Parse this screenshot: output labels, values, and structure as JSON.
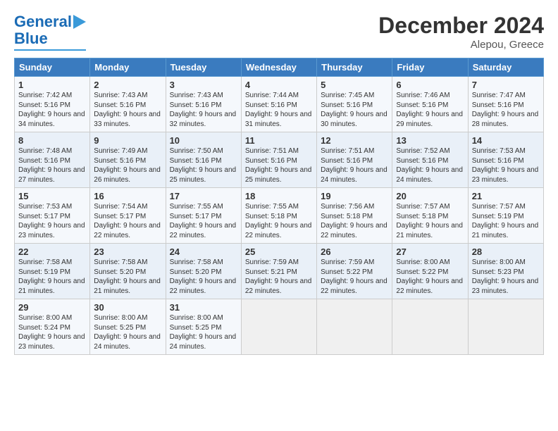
{
  "header": {
    "logo_line1": "General",
    "logo_line2": "Blue",
    "title": "December 2024",
    "subtitle": "Alepou, Greece"
  },
  "columns": [
    "Sunday",
    "Monday",
    "Tuesday",
    "Wednesday",
    "Thursday",
    "Friday",
    "Saturday"
  ],
  "weeks": [
    [
      {
        "day": "1",
        "sunrise": "7:42 AM",
        "sunset": "5:16 PM",
        "daylight": "9 hours and 34 minutes."
      },
      {
        "day": "2",
        "sunrise": "7:43 AM",
        "sunset": "5:16 PM",
        "daylight": "9 hours and 33 minutes."
      },
      {
        "day": "3",
        "sunrise": "7:43 AM",
        "sunset": "5:16 PM",
        "daylight": "9 hours and 32 minutes."
      },
      {
        "day": "4",
        "sunrise": "7:44 AM",
        "sunset": "5:16 PM",
        "daylight": "9 hours and 31 minutes."
      },
      {
        "day": "5",
        "sunrise": "7:45 AM",
        "sunset": "5:16 PM",
        "daylight": "9 hours and 30 minutes."
      },
      {
        "day": "6",
        "sunrise": "7:46 AM",
        "sunset": "5:16 PM",
        "daylight": "9 hours and 29 minutes."
      },
      {
        "day": "7",
        "sunrise": "7:47 AM",
        "sunset": "5:16 PM",
        "daylight": "9 hours and 28 minutes."
      }
    ],
    [
      {
        "day": "8",
        "sunrise": "7:48 AM",
        "sunset": "5:16 PM",
        "daylight": "9 hours and 27 minutes."
      },
      {
        "day": "9",
        "sunrise": "7:49 AM",
        "sunset": "5:16 PM",
        "daylight": "9 hours and 26 minutes."
      },
      {
        "day": "10",
        "sunrise": "7:50 AM",
        "sunset": "5:16 PM",
        "daylight": "9 hours and 25 minutes."
      },
      {
        "day": "11",
        "sunrise": "7:51 AM",
        "sunset": "5:16 PM",
        "daylight": "9 hours and 25 minutes."
      },
      {
        "day": "12",
        "sunrise": "7:51 AM",
        "sunset": "5:16 PM",
        "daylight": "9 hours and 24 minutes."
      },
      {
        "day": "13",
        "sunrise": "7:52 AM",
        "sunset": "5:16 PM",
        "daylight": "9 hours and 24 minutes."
      },
      {
        "day": "14",
        "sunrise": "7:53 AM",
        "sunset": "5:16 PM",
        "daylight": "9 hours and 23 minutes."
      }
    ],
    [
      {
        "day": "15",
        "sunrise": "7:53 AM",
        "sunset": "5:17 PM",
        "daylight": "9 hours and 23 minutes."
      },
      {
        "day": "16",
        "sunrise": "7:54 AM",
        "sunset": "5:17 PM",
        "daylight": "9 hours and 22 minutes."
      },
      {
        "day": "17",
        "sunrise": "7:55 AM",
        "sunset": "5:17 PM",
        "daylight": "9 hours and 22 minutes."
      },
      {
        "day": "18",
        "sunrise": "7:55 AM",
        "sunset": "5:18 PM",
        "daylight": "9 hours and 22 minutes."
      },
      {
        "day": "19",
        "sunrise": "7:56 AM",
        "sunset": "5:18 PM",
        "daylight": "9 hours and 22 minutes."
      },
      {
        "day": "20",
        "sunrise": "7:57 AM",
        "sunset": "5:18 PM",
        "daylight": "9 hours and 21 minutes."
      },
      {
        "day": "21",
        "sunrise": "7:57 AM",
        "sunset": "5:19 PM",
        "daylight": "9 hours and 21 minutes."
      }
    ],
    [
      {
        "day": "22",
        "sunrise": "7:58 AM",
        "sunset": "5:19 PM",
        "daylight": "9 hours and 21 minutes."
      },
      {
        "day": "23",
        "sunrise": "7:58 AM",
        "sunset": "5:20 PM",
        "daylight": "9 hours and 21 minutes."
      },
      {
        "day": "24",
        "sunrise": "7:58 AM",
        "sunset": "5:20 PM",
        "daylight": "9 hours and 22 minutes."
      },
      {
        "day": "25",
        "sunrise": "7:59 AM",
        "sunset": "5:21 PM",
        "daylight": "9 hours and 22 minutes."
      },
      {
        "day": "26",
        "sunrise": "7:59 AM",
        "sunset": "5:22 PM",
        "daylight": "9 hours and 22 minutes."
      },
      {
        "day": "27",
        "sunrise": "8:00 AM",
        "sunset": "5:22 PM",
        "daylight": "9 hours and 22 minutes."
      },
      {
        "day": "28",
        "sunrise": "8:00 AM",
        "sunset": "5:23 PM",
        "daylight": "9 hours and 23 minutes."
      }
    ],
    [
      {
        "day": "29",
        "sunrise": "8:00 AM",
        "sunset": "5:24 PM",
        "daylight": "9 hours and 23 minutes."
      },
      {
        "day": "30",
        "sunrise": "8:00 AM",
        "sunset": "5:25 PM",
        "daylight": "9 hours and 24 minutes."
      },
      {
        "day": "31",
        "sunrise": "8:00 AM",
        "sunset": "5:25 PM",
        "daylight": "9 hours and 24 minutes."
      },
      null,
      null,
      null,
      null
    ]
  ]
}
